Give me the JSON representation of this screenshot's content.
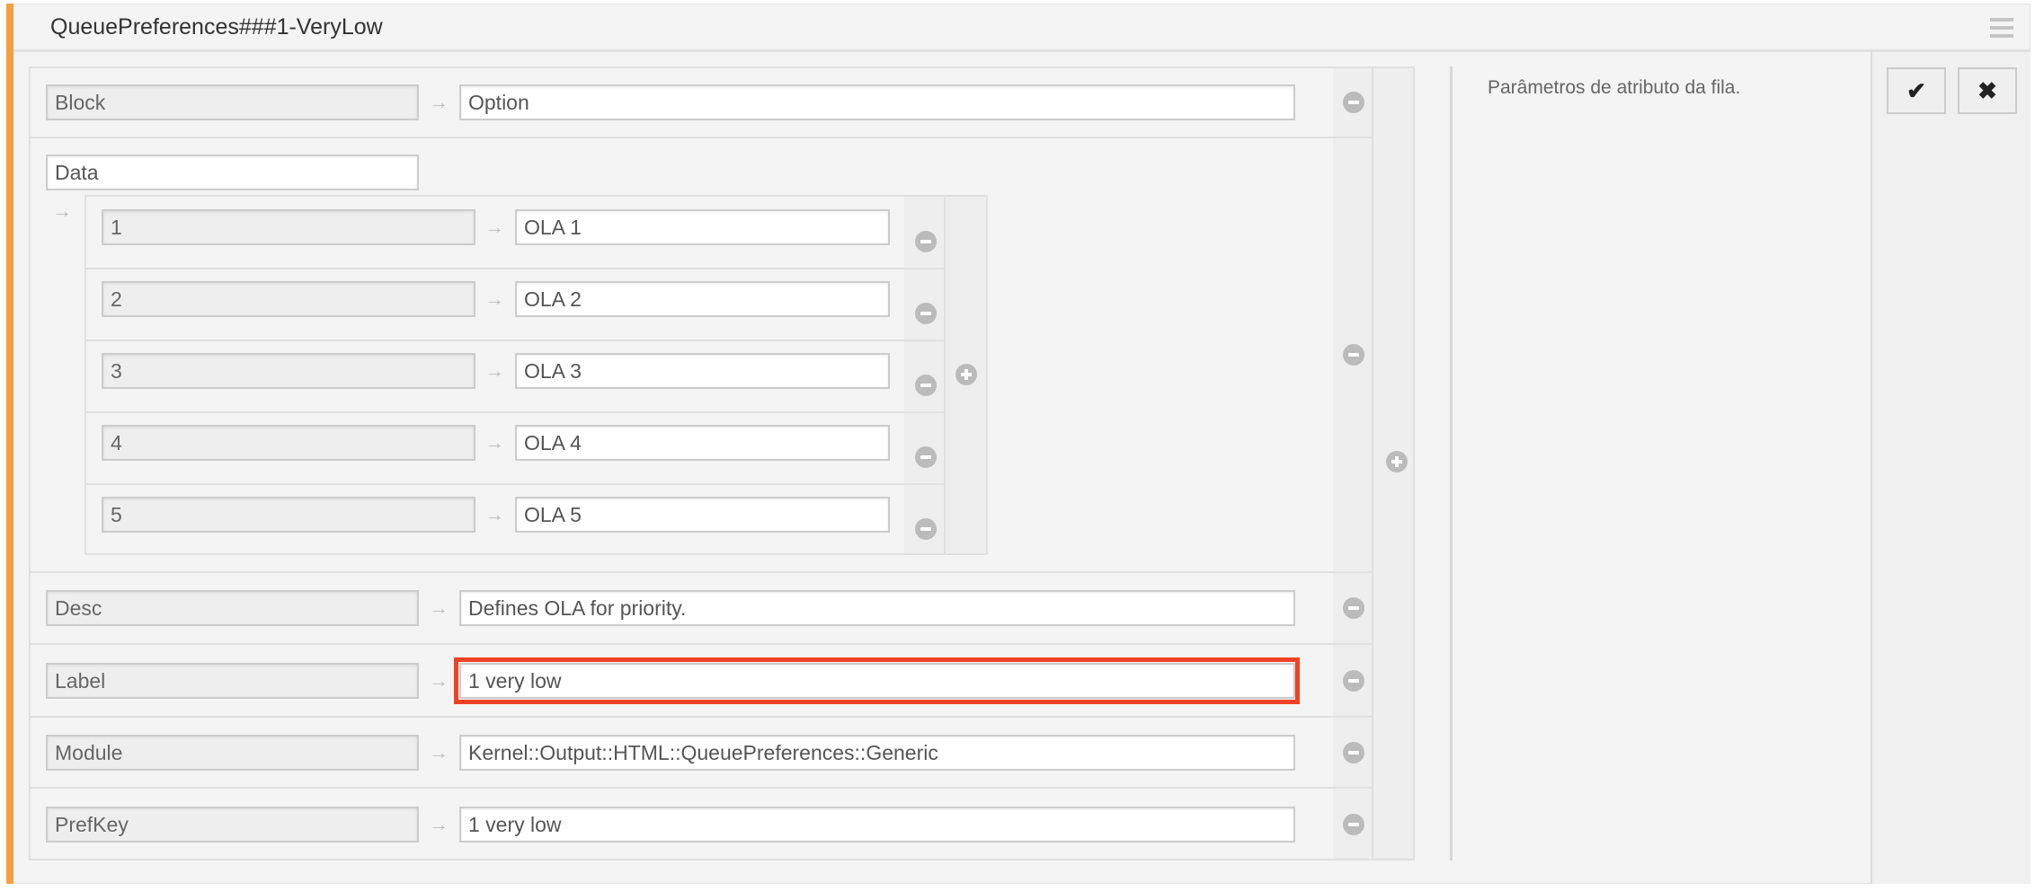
{
  "header": {
    "title": "QueuePreferences###1-VeryLow",
    "menu_icon": "hamburger-icon"
  },
  "description": "Parâmetros de atributo da fila.",
  "actions": {
    "save_icon": "check-icon",
    "save_glyph": "✔",
    "cancel_icon": "close-icon",
    "cancel_glyph": "✖"
  },
  "arrow_glyph": "→",
  "colors": {
    "accent": "#f4a040",
    "highlight": "#f04226"
  },
  "rows": [
    {
      "key": "Block",
      "value": "Option"
    },
    {
      "key": "Data",
      "items": [
        {
          "key": "1",
          "value": "OLA 1"
        },
        {
          "key": "2",
          "value": "OLA 2"
        },
        {
          "key": "3",
          "value": "OLA 3"
        },
        {
          "key": "4",
          "value": "OLA 4"
        },
        {
          "key": "5",
          "value": "OLA 5"
        }
      ]
    },
    {
      "key": "Desc",
      "value": "Defines OLA for priority."
    },
    {
      "key": "Label",
      "value": "1 very low",
      "highlighted": true
    },
    {
      "key": "Module",
      "value": "Kernel::Output::HTML::QueuePreferences::Generic"
    },
    {
      "key": "PrefKey",
      "value": "1 very low"
    }
  ]
}
